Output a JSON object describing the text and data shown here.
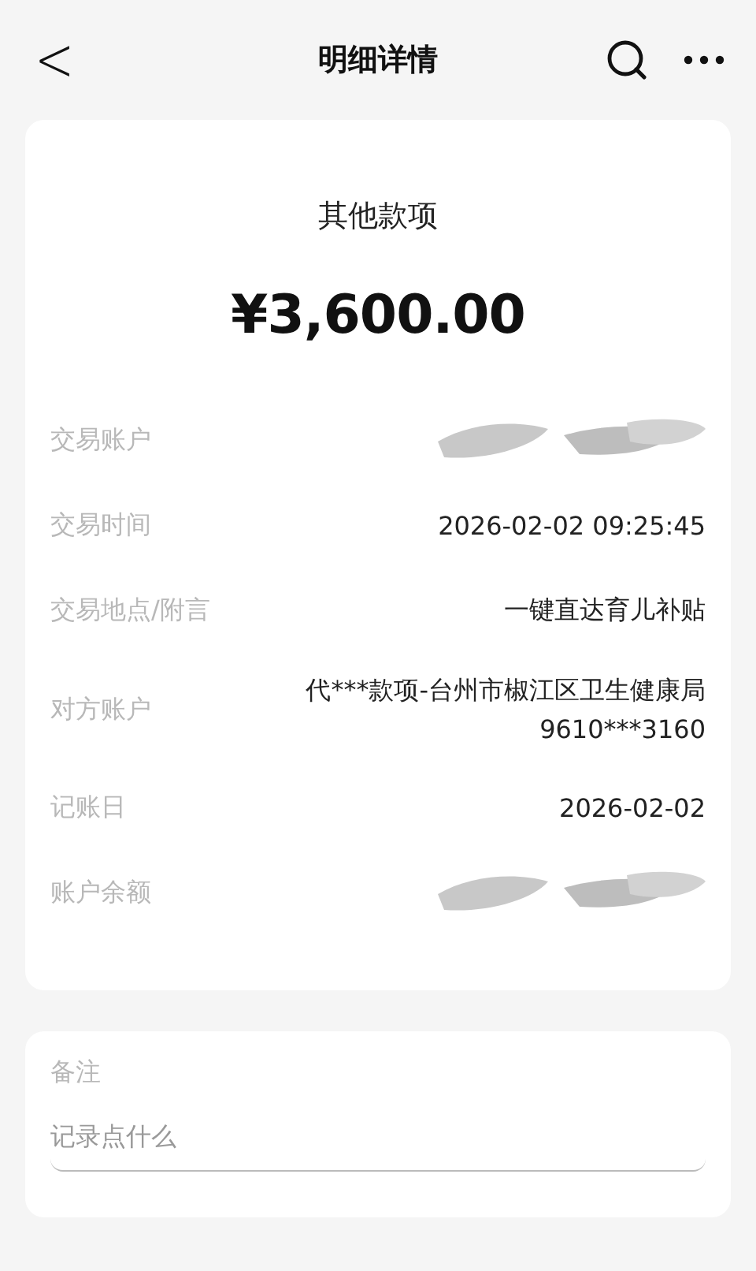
{
  "header": {
    "back": "<",
    "title": "明细详情"
  },
  "summary": {
    "category": "其他款项",
    "amount": "¥3,600.00"
  },
  "rows": [
    {
      "label": "交易账户",
      "kind": "redacted"
    },
    {
      "label": "交易时间",
      "kind": "text",
      "lines": [
        "2026-02-02 09:25:45"
      ]
    },
    {
      "label": "交易地点/附言",
      "kind": "text",
      "lines": [
        "一键直达育儿补贴"
      ]
    },
    {
      "label": "对方账户",
      "kind": "text",
      "lines": [
        "代***款项-台州市椒江区卫生健康局",
        "9610***3160"
      ]
    },
    {
      "label": "记账日",
      "kind": "text",
      "lines": [
        "2026-02-02"
      ]
    },
    {
      "label": "账户余额",
      "kind": "redacted"
    }
  ],
  "note": {
    "label": "备注",
    "placeholder": "记录点什么"
  }
}
